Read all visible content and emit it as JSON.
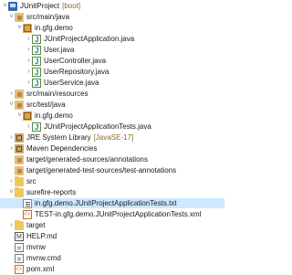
{
  "tree": [
    {
      "label": "JUnitProject",
      "decoration": "[boot]",
      "twisty": "open",
      "icon": "project-icon"
    },
    {
      "label": "src/main/java",
      "twisty": "open",
      "icon": "source-folder-icon"
    },
    {
      "label": "in.gfg.demo",
      "twisty": "open",
      "icon": "package-icon"
    },
    {
      "label": "JUnitProjectApplication.java",
      "twisty": "closed",
      "icon": "java-file-icon"
    },
    {
      "label": "User.java",
      "twisty": "closed",
      "icon": "java-file-icon"
    },
    {
      "label": "UserController.java",
      "twisty": "closed",
      "icon": "java-file-icon"
    },
    {
      "label": "UserRepository.java",
      "twisty": "closed",
      "icon": "java-file-icon"
    },
    {
      "label": "UserService.java",
      "twisty": "closed",
      "icon": "java-file-icon"
    },
    {
      "label": "src/main/resources",
      "twisty": "closed",
      "icon": "source-folder-icon"
    },
    {
      "label": "src/test/java",
      "twisty": "open",
      "icon": "source-folder-icon"
    },
    {
      "label": "in.gfg.demo",
      "twisty": "open",
      "icon": "package-icon"
    },
    {
      "label": "JUnitProjectApplicationTests.java",
      "twisty": "closed",
      "icon": "java-file-icon"
    },
    {
      "label": "JRE System Library",
      "decoration": "[JavaSE-17]",
      "twisty": "closed",
      "icon": "library-icon"
    },
    {
      "label": "Maven Dependencies",
      "twisty": "closed",
      "icon": "library-icon"
    },
    {
      "label": "target/generated-sources/annotations",
      "twisty": "none",
      "icon": "source-folder-icon"
    },
    {
      "label": "target/generated-test-sources/test-annotations",
      "twisty": "none",
      "icon": "source-folder-icon"
    },
    {
      "label": "src",
      "twisty": "closed",
      "icon": "folder-icon"
    },
    {
      "label": "surefire-reports",
      "twisty": "open",
      "icon": "folder-icon"
    },
    {
      "label": "in.gfg.demo.JUnitProjectApplicationTests.txt",
      "twisty": "none",
      "icon": "text-file-icon",
      "selected": true
    },
    {
      "label": "TEST-in.gfg.demo.JUnitProjectApplicationTests.xml",
      "twisty": "none",
      "icon": "xml-file-icon"
    },
    {
      "label": "target",
      "twisty": "closed",
      "icon": "folder-icon"
    },
    {
      "label": "HELP.md",
      "twisty": "none",
      "icon": "markdown-file-icon"
    },
    {
      "label": "mvnw",
      "twisty": "none",
      "icon": "file-icon"
    },
    {
      "label": "mvnw.cmd",
      "twisty": "none",
      "icon": "file-icon"
    },
    {
      "label": "pom.xml",
      "twisty": "none",
      "icon": "xml-file-icon"
    }
  ],
  "colors": {
    "selection": "#cde8ff",
    "decoration": "#8a6a2e"
  }
}
